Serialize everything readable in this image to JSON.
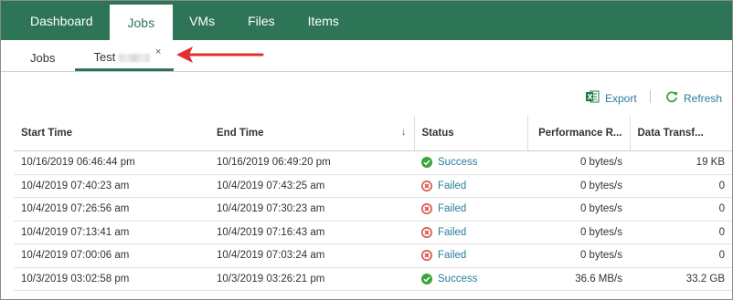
{
  "nav": {
    "tabs": [
      {
        "label": "Dashboard"
      },
      {
        "label": "Jobs"
      },
      {
        "label": "VMs"
      },
      {
        "label": "Files"
      },
      {
        "label": "Items"
      }
    ],
    "active_index": 1
  },
  "subtabs": {
    "items": [
      {
        "label": "Jobs"
      },
      {
        "label": "Test"
      }
    ],
    "close_glyph": "×"
  },
  "toolbar": {
    "export_label": "Export",
    "refresh_label": "Refresh"
  },
  "table": {
    "columns": [
      "Start Time",
      "End Time",
      "Status",
      "Performance R...",
      "Data Transf..."
    ],
    "sort_glyph": "↓",
    "rows": [
      {
        "start": "10/16/2019 06:46:44 pm",
        "end": "10/16/2019 06:49:20 pm",
        "status": "Success",
        "perf": "0 bytes/s",
        "data": "19 KB"
      },
      {
        "start": "10/4/2019 07:40:23 am",
        "end": "10/4/2019 07:43:25 am",
        "status": "Failed",
        "perf": "0 bytes/s",
        "data": "0"
      },
      {
        "start": "10/4/2019 07:26:56 am",
        "end": "10/4/2019 07:30:23 am",
        "status": "Failed",
        "perf": "0 bytes/s",
        "data": "0"
      },
      {
        "start": "10/4/2019 07:13:41 am",
        "end": "10/4/2019 07:16:43 am",
        "status": "Failed",
        "perf": "0 bytes/s",
        "data": "0"
      },
      {
        "start": "10/4/2019 07:00:06 am",
        "end": "10/4/2019 07:03:24 am",
        "status": "Failed",
        "perf": "0 bytes/s",
        "data": "0"
      },
      {
        "start": "10/3/2019 03:02:58 pm",
        "end": "10/3/2019 03:26:21 pm",
        "status": "Success",
        "perf": "36.6 MB/s",
        "data": "33.2 GB"
      }
    ]
  },
  "colors": {
    "brand": "#2e7558",
    "link": "#2a7d9e",
    "success": "#3aa53a",
    "failed": "#d9534f",
    "annotation_arrow": "#e03131"
  },
  "icons": {
    "export": "excel-icon",
    "refresh": "refresh-icon",
    "success": "check-circle-icon",
    "failed": "x-circle-icon"
  }
}
